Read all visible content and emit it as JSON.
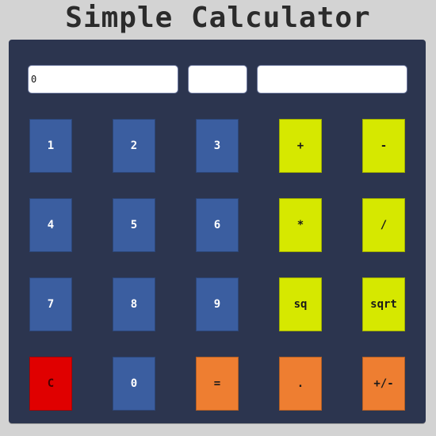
{
  "app": {
    "title": "Simple Calculator"
  },
  "fields": {
    "a_value": "0",
    "b_value": "",
    "c_value": ""
  },
  "buttons": {
    "row1": [
      "1",
      "2",
      "3",
      "+",
      "-"
    ],
    "row2": [
      "4",
      "5",
      "6",
      "*",
      "/"
    ],
    "row3": [
      "7",
      "8",
      "9",
      "sq",
      "sqrt"
    ],
    "row4": [
      "C",
      "0",
      "=",
      ".",
      "+/-"
    ]
  },
  "colors": {
    "background": "#d3d3d3",
    "panel": "#2c354f",
    "digit_button": "#3b5ea0",
    "operator_button": "#d6e800",
    "action_button": "#ee7e31",
    "clear_button": "#e00000",
    "title_text": "#2b2b2b"
  }
}
